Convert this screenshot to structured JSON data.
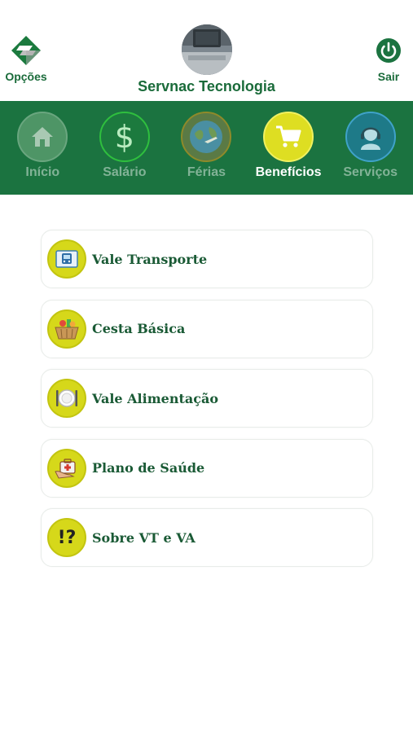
{
  "header": {
    "options_label": "Opções",
    "company": "Servnac Tecnologia",
    "logout_label": "Sair"
  },
  "nav": {
    "items": [
      {
        "label": "Início",
        "icon": "home-icon"
      },
      {
        "label": "Salário",
        "icon": "dollar-icon"
      },
      {
        "label": "Férias",
        "icon": "globe-plane-icon"
      },
      {
        "label": "Benefícios",
        "icon": "cart-icon",
        "active": true
      },
      {
        "label": "Serviços",
        "icon": "headset-agent-icon"
      }
    ]
  },
  "benefits": {
    "items": [
      {
        "label": "Vale Transporte",
        "icon": "bus-ticket-icon"
      },
      {
        "label": "Cesta Básica",
        "icon": "basket-icon"
      },
      {
        "label": "Vale Alimentação",
        "icon": "plate-cutlery-icon"
      },
      {
        "label": "Plano de Saúde",
        "icon": "medical-kit-icon"
      },
      {
        "label": "Sobre VT e VA",
        "icon": "question-icon"
      }
    ]
  },
  "colors": {
    "brand_green": "#1b7340",
    "accent_yellow": "#d6d81a",
    "text_green": "#1a6b3a"
  }
}
